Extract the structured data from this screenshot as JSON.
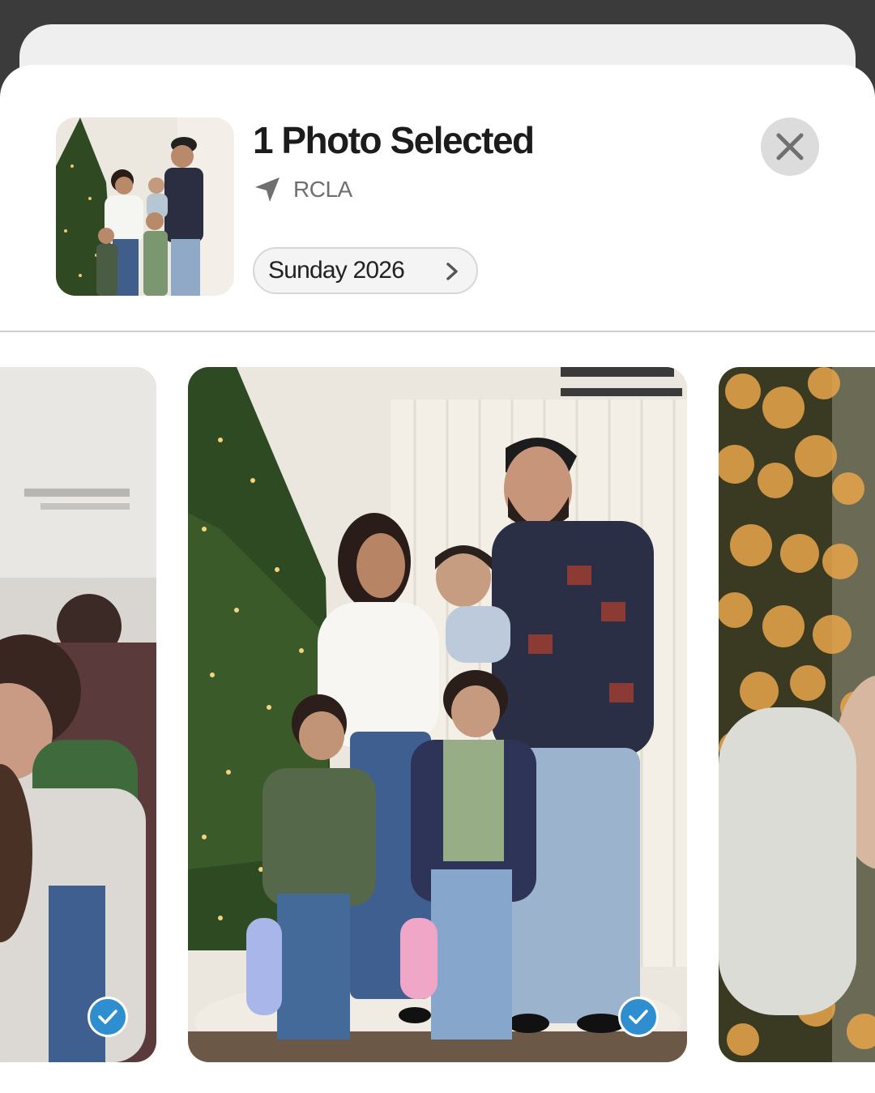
{
  "header": {
    "title": "1 Photo Selected",
    "location": "RCLA",
    "album_chip_label": "Sunday 2026"
  },
  "icons": {
    "location": "location-arrow-icon",
    "chip": "chevron-right-icon",
    "close": "close-icon",
    "selected": "checkmark-icon"
  },
  "photos": [
    {
      "id": "left",
      "selected": true
    },
    {
      "id": "center",
      "selected": true
    },
    {
      "id": "right",
      "selected": false
    }
  ],
  "colors": {
    "accent_check": "#2f8ed0",
    "sheet_bg": "#ffffff",
    "backdrop": "#3b3b3b"
  }
}
